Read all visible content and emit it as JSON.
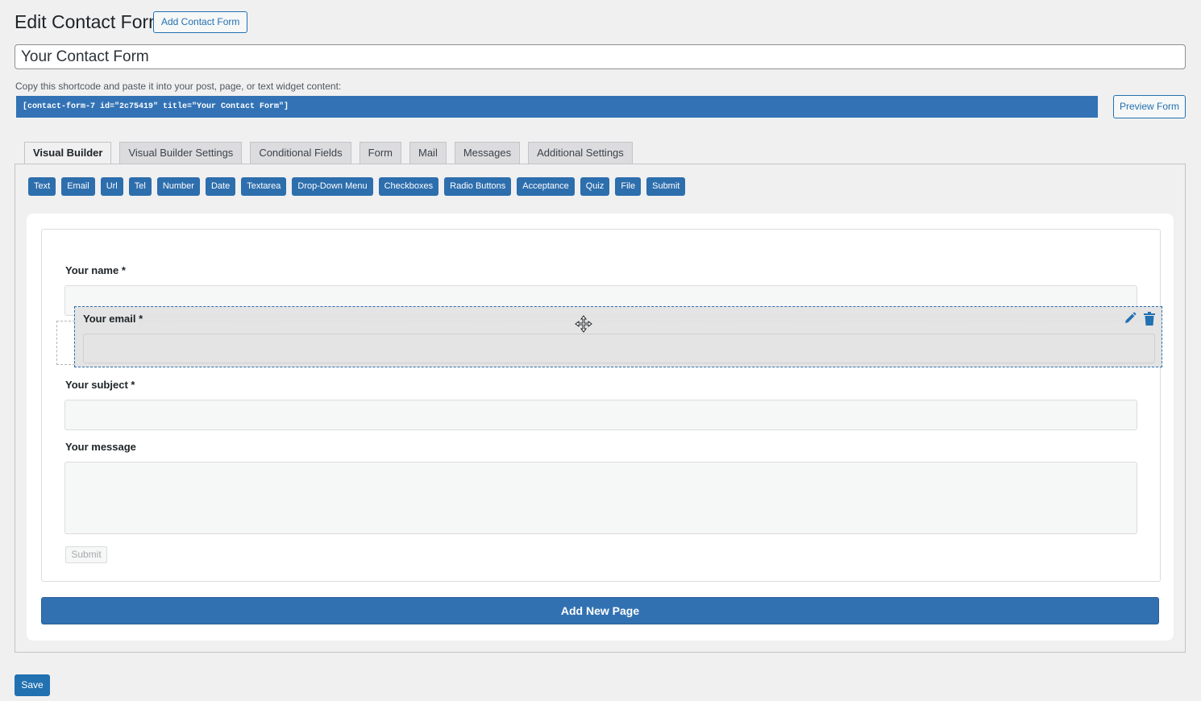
{
  "header": {
    "title": "Edit Contact Form",
    "add_button": "Add Contact Form"
  },
  "form_title": {
    "value": "Your Contact Form"
  },
  "shortcode": {
    "label": "Copy this shortcode and paste it into your post, page, or text widget content:",
    "code": "[contact-form-7 id=\"2c75419\" title=\"Your Contact Form\"]",
    "preview_button": "Preview Form"
  },
  "tabs": [
    {
      "label": "Visual Builder",
      "active": true
    },
    {
      "label": "Visual Builder Settings",
      "active": false
    },
    {
      "label": "Conditional Fields",
      "active": false
    },
    {
      "label": "Form",
      "active": false
    },
    {
      "label": "Mail",
      "active": false
    },
    {
      "label": "Messages",
      "active": false
    },
    {
      "label": "Additional Settings",
      "active": false
    }
  ],
  "field_buttons": [
    "Text",
    "Email",
    "Url",
    "Tel",
    "Number",
    "Date",
    "Textarea",
    "Drop-Down Menu",
    "Checkboxes",
    "Radio Buttons",
    "Acceptance",
    "Quiz",
    "File",
    "Submit"
  ],
  "form_fields": {
    "name_label": "Your name *",
    "email_label": "Your email *",
    "subject_label": "Your subject *",
    "message_label": "Your message",
    "submit_label": "Submit"
  },
  "icons": {
    "move": "move-icon",
    "edit": "pencil-icon",
    "delete": "trash-icon"
  },
  "add_page_button": "Add New Page",
  "save_button": "Save",
  "colors": {
    "accent": "#2271b1",
    "shortcode_bg": "#3373b5",
    "field_button_bg": "#2d6ead"
  }
}
